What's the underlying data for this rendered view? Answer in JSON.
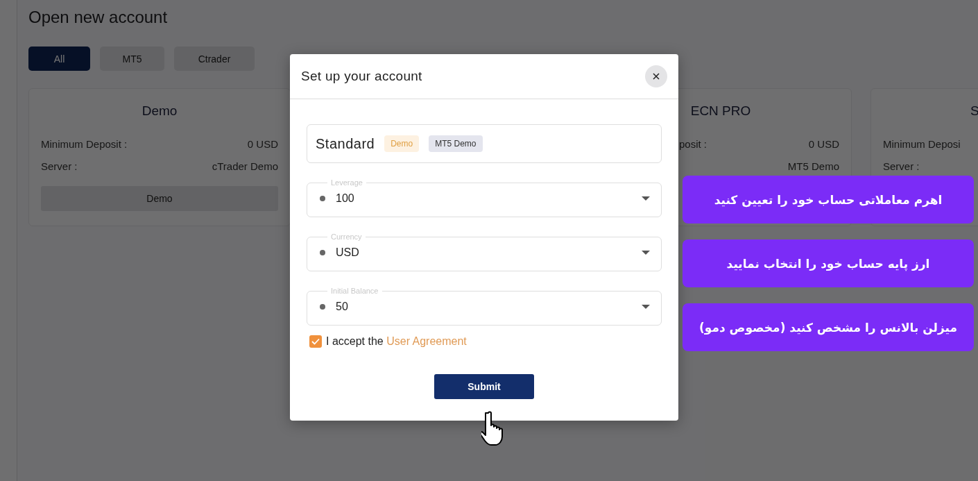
{
  "page": {
    "title": "Open new account"
  },
  "filter_tabs": [
    {
      "label": "All",
      "selected": true
    },
    {
      "label": "MT5",
      "selected": false
    },
    {
      "label": "Ctrader",
      "selected": false
    }
  ],
  "account_cards": [
    {
      "title": "Demo",
      "rows": [
        {
          "label": "Minimum Deposit :",
          "value": "0 USD"
        },
        {
          "label": "Server :",
          "value": "cTrader Demo"
        }
      ],
      "button": "Demo"
    },
    {
      "title": "ECN PRO",
      "rows": [
        {
          "label": "posit :",
          "value": "0 USD"
        },
        {
          "value": "MT5 Demo"
        }
      ]
    },
    {
      "title": "S",
      "rows": [
        {
          "label": "Minimum Deposi"
        },
        {
          "label": "Server :"
        }
      ]
    }
  ],
  "dialog": {
    "title": "Set up your account",
    "account": {
      "name": "Standard",
      "badges": [
        {
          "label": "Demo",
          "kind": "type"
        },
        {
          "label": "MT5 Demo",
          "kind": "server"
        }
      ]
    },
    "fields": [
      {
        "label": "Leverage",
        "value": "100"
      },
      {
        "label": "Currency",
        "value": "USD"
      },
      {
        "label": "Initial Balance",
        "value": "50"
      }
    ],
    "agreement": {
      "checked": true,
      "text": "I accept the ",
      "link": "User Agreement"
    },
    "submit": "Submit"
  },
  "callouts": [
    {
      "text": "اهرم معاملاتی حساب خود را تعیین کنید"
    },
    {
      "text": "ارز پایه حساب خود را انتخاب نمایید"
    },
    {
      "text": "میزلن بالانس را مشخص کنید (مخصوص دمو)"
    }
  ]
}
